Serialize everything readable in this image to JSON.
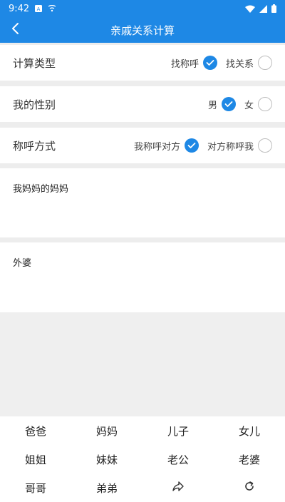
{
  "status_bar": {
    "time": "9:42"
  },
  "app_bar": {
    "title": "亲戚关系计算"
  },
  "rows": {
    "calc_type": {
      "label": "计算类型",
      "opt1": "找称呼",
      "opt2": "找关系"
    },
    "gender": {
      "label": "我的性别",
      "opt1": "男",
      "opt2": "女"
    },
    "address_mode": {
      "label": "称呼方式",
      "opt1": "我称呼对方",
      "opt2": "对方称呼我"
    }
  },
  "input_text": "我妈妈的妈妈",
  "result_text": "外婆",
  "keyboard": {
    "row1": [
      "爸爸",
      "妈妈",
      "儿子",
      "女儿"
    ],
    "row2": [
      "姐姐",
      "妹妹",
      "老公",
      "老婆"
    ],
    "row3": [
      "哥哥",
      "弟弟"
    ]
  },
  "colors": {
    "primary": "#1e88e5"
  },
  "icons": {
    "back": "chevron-left-icon",
    "share": "share-arrow-icon",
    "reset": "refresh-icon"
  }
}
